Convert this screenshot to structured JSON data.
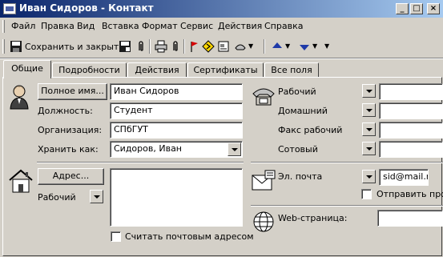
{
  "window": {
    "title": "Иван Сидоров - Контакт",
    "minimize_glyph": "_",
    "maximize_glyph": "□",
    "close_glyph": "×"
  },
  "menu": [
    "Файл",
    "Правка",
    "Вид",
    "Вставка",
    "Формат",
    "Сервис",
    "Действия",
    "Справка"
  ],
  "toolbar": {
    "save_close_label": "Сохранить и закрыть"
  },
  "tabs": [
    "Общие",
    "Подробности",
    "Действия",
    "Сертификаты",
    "Все поля"
  ],
  "active_tab": "Общие",
  "general": {
    "full_name_button": "Полное имя...",
    "full_name_value": "Иван Сидоров",
    "job_title_label": "Должность:",
    "job_title_value": "Студент",
    "company_label": "Организация:",
    "company_value": "СПбГУТ",
    "file_as_label": "Хранить как:",
    "file_as_value": "Сидоров, Иван",
    "address_button": "Адрес...",
    "address_type": "Рабочий",
    "address_value": "",
    "mailing_address_label": "Считать почтовым адресом",
    "mailing_address_checked": false
  },
  "phones": [
    {
      "label": "Рабочий",
      "value": ""
    },
    {
      "label": "Домашний",
      "value": ""
    },
    {
      "label": "Факс рабочий",
      "value": ""
    },
    {
      "label": "Сотовый",
      "value": ""
    }
  ],
  "email": {
    "label": "Эл. почта",
    "value": "sid@mail.ru",
    "send_plain_label": "Отправить про",
    "send_plain_checked": false
  },
  "web": {
    "label": "Web-страница:",
    "value": ""
  },
  "colors": {
    "title_gradient_start": "#0a246a",
    "title_gradient_end": "#a6caf0",
    "face": "#d4d0c8"
  }
}
